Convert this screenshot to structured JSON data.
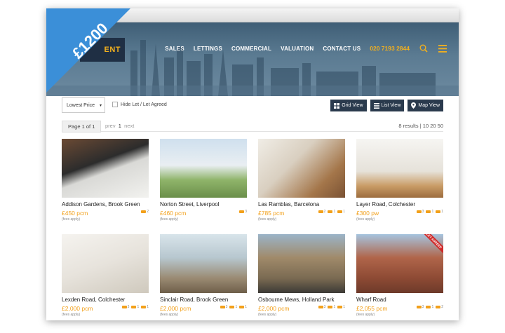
{
  "price_ribbon": "£1200",
  "brand": {
    "logo_text": "ENT"
  },
  "nav": {
    "items": [
      "SALES",
      "LETTINGS",
      "COMMERCIAL",
      "VALUATION",
      "CONTACT US"
    ],
    "phone": "020 7193 2844",
    "icons": [
      "search-icon",
      "menu-icon"
    ]
  },
  "filters": {
    "sort_value": "Lowest Price",
    "hide_let_label": "Hide Let / Let Agreed",
    "views": [
      "Grid View",
      "List View",
      "Map View"
    ]
  },
  "pagination": {
    "page_label": "Page 1 of 1",
    "prev": "prev",
    "current": "1",
    "next": "next",
    "results": "8 results",
    "per_page": "10 20 50"
  },
  "listings": [
    {
      "title": "Addison Gardens, Brook Green",
      "price": "£450 pcm",
      "fees": "(fees apply)",
      "beds": "2",
      "baths": "",
      "recep": ""
    },
    {
      "title": "Norton Street, Liverpool",
      "price": "£460 pcm",
      "fees": "(fees apply)",
      "beds": "3",
      "baths": "",
      "recep": ""
    },
    {
      "title": "Las Ramblas, Barcelona",
      "price": "£785 pcm",
      "fees": "(fees apply)",
      "beds": "2",
      "baths": "1",
      "recep": "1"
    },
    {
      "title": "Layer Road, Colchester",
      "price": "£300 pw",
      "fees": "(fees apply)",
      "beds": "3",
      "baths": "1",
      "recep": "1"
    },
    {
      "title": "Lexden Road, Colchester",
      "price": "£2,000 pcm",
      "fees": "(fees apply)",
      "beds": "3",
      "baths": "1",
      "recep": "1"
    },
    {
      "title": "Sinclair Road, Brook Green",
      "price": "£2,000 pcm",
      "fees": "(fees apply)",
      "beds": "3",
      "baths": "1",
      "recep": "1"
    },
    {
      "title": "Osbourne Mews, Holland Park",
      "price": "£2,000 pcm",
      "fees": "(fees apply)",
      "beds": "3",
      "baths": "1",
      "recep": "1"
    },
    {
      "title": "Wharf Road",
      "price": "£2,055 pcm",
      "fees": "(fees apply)",
      "beds": "3",
      "baths": "1",
      "recep": "2",
      "badge": "LET AGREED"
    }
  ],
  "colors": {
    "accent": "#f2a01a",
    "ribbon": "#3b8fd8",
    "dark": "#2a3a4d"
  }
}
